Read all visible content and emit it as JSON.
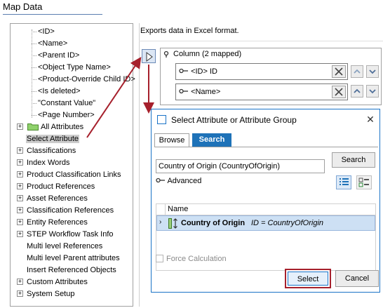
{
  "header": {
    "title": "Map Data"
  },
  "tree": {
    "items": [
      {
        "label": "<ID>"
      },
      {
        "label": "<Name>"
      },
      {
        "label": "<Parent ID>"
      },
      {
        "label": "<Object Type Name>"
      },
      {
        "label": "<Product-Override Child ID>"
      },
      {
        "label": "<Is deleted>"
      },
      {
        "label": "\"Constant Value\""
      },
      {
        "label": "<Page Number>"
      },
      {
        "label": "All Attributes"
      },
      {
        "label": "Select Attribute"
      },
      {
        "label": "Classifications"
      },
      {
        "label": "Index Words"
      },
      {
        "label": "Product Classification Links"
      },
      {
        "label": "Product References"
      },
      {
        "label": "Asset References"
      },
      {
        "label": "Classification References"
      },
      {
        "label": "Entity References"
      },
      {
        "label": "STEP Workflow Task Info"
      },
      {
        "label": "Multi level References"
      },
      {
        "label": "Multi level Parent attributes"
      },
      {
        "label": "Insert Referenced Objects"
      },
      {
        "label": "Custom Attributes"
      },
      {
        "label": "System Setup"
      }
    ]
  },
  "right": {
    "description": "Exports data in Excel format.",
    "column_header": "Column (2 mapped)",
    "mapped": [
      {
        "label": "<ID> ID"
      },
      {
        "label": "<Name>"
      }
    ]
  },
  "dialog": {
    "title": "Select Attribute or Attribute Group",
    "tabs": {
      "browse": "Browse",
      "search": "Search"
    },
    "search_value": "Country of Origin (CountryOfOrigin)",
    "search_button": "Search",
    "advanced": "Advanced",
    "table": {
      "column": "Name",
      "row_name": "Country of Origin",
      "row_id": "ID = CountryOfOrigin"
    },
    "force_calculation": "Force Calculation",
    "select_button": "Select",
    "cancel_button": "Cancel"
  },
  "colors": {
    "accent": "#1e72b8",
    "highlight_red": "#a6202c",
    "selection_bg": "#cde0f4"
  }
}
